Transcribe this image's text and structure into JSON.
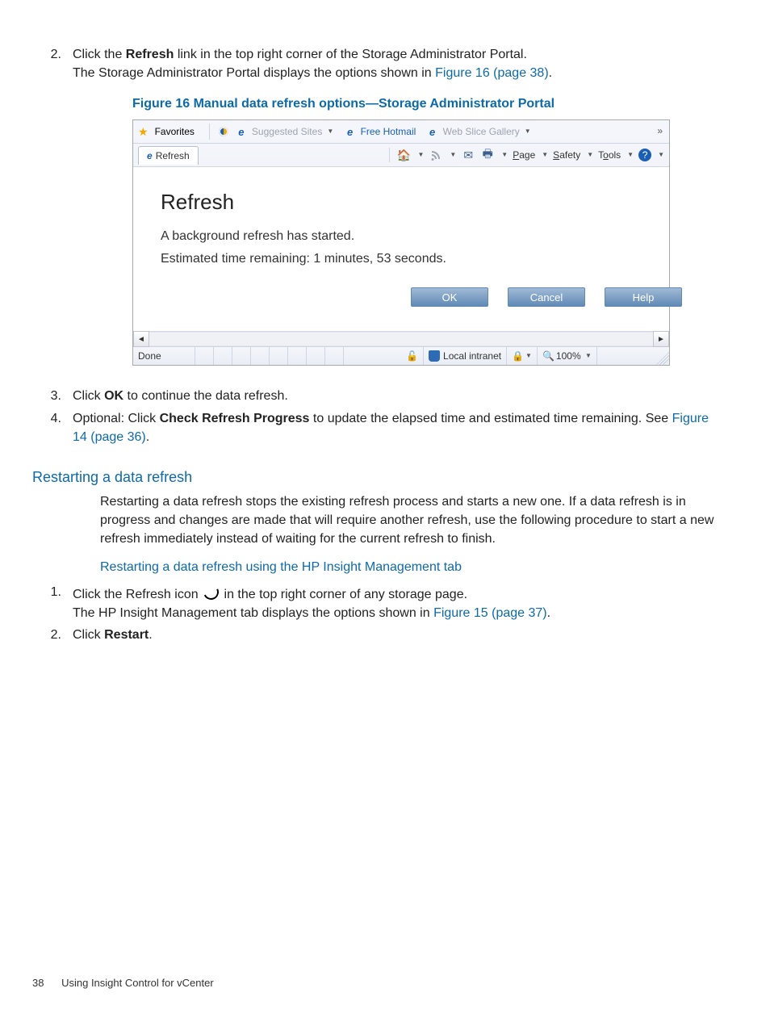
{
  "steps_top": [
    {
      "n": "2.",
      "pre": "Click the ",
      "bold": "Refresh",
      "post": " link in the top right corner of the Storage Administrator Portal.",
      "line2_pre": "The Storage Administrator Portal displays the options shown in ",
      "link": "Figure 16 (page 38)",
      "line2_post": "."
    }
  ],
  "figure_caption": "Figure 16 Manual data refresh options—Storage Administrator Portal",
  "shot": {
    "favorites_label": "Favorites",
    "suggested": "Suggested Sites",
    "hotmail": "Free Hotmail",
    "webslice": "Web Slice Gallery",
    "tab_label": "Refresh",
    "menu": {
      "page": "Page",
      "safety": "Safety",
      "tools": "Tools"
    },
    "content": {
      "heading": "Refresh",
      "line1": "A background refresh has started.",
      "line2": "Estimated time remaining: 1 minutes, 53 seconds.",
      "ok": "OK",
      "cancel": "Cancel",
      "help": "Help"
    },
    "status": {
      "done": "Done",
      "zone": "Local intranet",
      "zoom": "100%"
    }
  },
  "steps_after": [
    {
      "n": "3.",
      "pre": "Click ",
      "bold": "OK",
      "post": " to continue the data refresh."
    },
    {
      "n": "4.",
      "pre": "Optional: Click ",
      "bold": "Check Refresh Progress",
      "post": " to update the elapsed time and estimated time remaining. See ",
      "link": "Figure 14 (page 36)",
      "tail": "."
    }
  ],
  "section_heading": "Restarting a data refresh",
  "section_para": "Restarting a data refresh stops the existing refresh process and starts a new one. If a data refresh is in progress and changes are made that will require another refresh, use the following procedure to start a new refresh immediately instead of waiting for the current refresh to finish.",
  "sub_heading": "Restarting a data refresh using the HP Insight Management tab",
  "steps_bottom": [
    {
      "n": "1.",
      "pre": "Click the Refresh icon ",
      "post_icon": " in the top right corner of any storage page.",
      "line2_pre": "The HP Insight Management tab displays the options shown in ",
      "link": "Figure 15 (page 37)",
      "line2_post": "."
    },
    {
      "n": "2.",
      "pre": "Click ",
      "bold": "Restart",
      "post": "."
    }
  ],
  "footer": {
    "page": "38",
    "title": "Using Insight Control for vCenter"
  }
}
